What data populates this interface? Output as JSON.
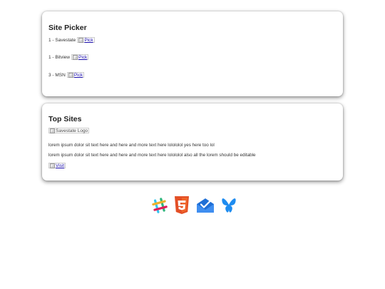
{
  "picker": {
    "title": "Site Picker",
    "rows": [
      {
        "label": "1 - Savestate",
        "link": "Pick"
      },
      {
        "label": "1 - Bitview",
        "link": "Pick"
      },
      {
        "label": "3 - MSN",
        "link": "Pick"
      }
    ]
  },
  "top_sites": {
    "title": "Top Sites",
    "logo_alt": "Savestate Logo",
    "paragraphs": [
      "lorem ipsum dolor sit text here and here and more text here lolololol yes here too lol",
      "lorem ipsum dolor sit text here and here and more text here lolololol also all the lorem should be editable"
    ],
    "visit_link": "Visit"
  },
  "footer_icons": [
    "slack-icon",
    "html5-icon",
    "inbox-icon",
    "bluesky-icon"
  ],
  "colors": {
    "link": "#1a0dab",
    "html5": "#e34f26",
    "inbox": "#1f6fd6",
    "bluesky": "#1e8cf0"
  }
}
